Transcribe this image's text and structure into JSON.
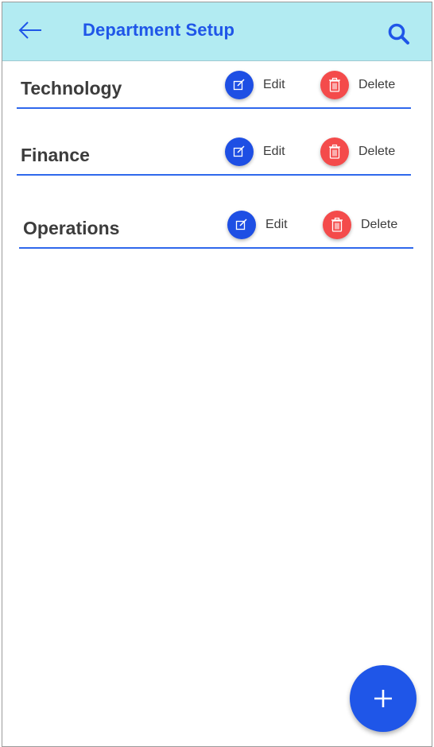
{
  "app_bar": {
    "title": "Department Setup",
    "back_icon": "arrow-left-icon",
    "search_icon": "search-icon"
  },
  "departments": [
    {
      "name": "Technology",
      "edit_label": "Edit",
      "delete_label": "Delete"
    },
    {
      "name": "Finance",
      "edit_label": "Edit",
      "delete_label": "Delete"
    },
    {
      "name": "Operations",
      "edit_label": "Edit",
      "delete_label": "Delete"
    }
  ],
  "fab": {
    "icon": "plus-icon"
  },
  "colors": {
    "app_bar_bg": "#b2ebf2",
    "primary_blue": "#1f56e8",
    "delete_red": "#f44b4b",
    "text_dark": "#3c3c3c",
    "divider": "#2f68ec"
  }
}
